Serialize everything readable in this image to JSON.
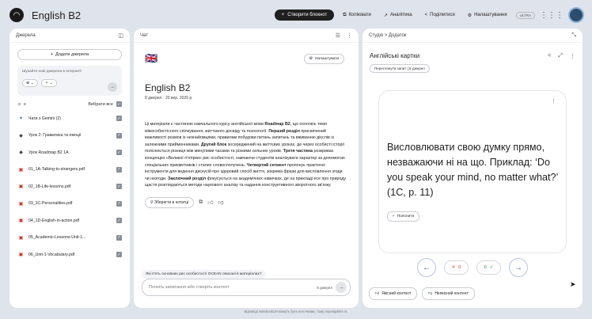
{
  "app": {
    "notebook_title": "English B2",
    "logo_glyph": "◠"
  },
  "topbar": {
    "create_label": "Створити блокнот",
    "copy_label": "Копіювати",
    "analytics_label": "Аналітика",
    "share_label": "Поділитися",
    "settings_label": "Налаштування",
    "plan_badge": "ULTRA"
  },
  "sources": {
    "header": "Джерела",
    "add_label": "Додати джерела",
    "search_placeholder": "Шукайте нові джерела в Інтернеті",
    "select_all_label": "Вибрати все",
    "items": [
      {
        "label": "Чати з Gemini (2)",
        "icon": "gemini-icon"
      },
      {
        "label": "Урок 2: Граматика та емоції",
        "icon": "note-icon"
      },
      {
        "label": "Урок Roadmap B2 1A",
        "icon": "note-icon"
      },
      {
        "label": "01_1A-Talking-to-strangers.pdf",
        "icon": "pdf-icon"
      },
      {
        "label": "02_1B-Life-lessons.pdf",
        "icon": "pdf-icon"
      },
      {
        "label": "03_1C-Personalities.pdf",
        "icon": "pdf-icon"
      },
      {
        "label": "04_1D-English-in-action.pdf",
        "icon": "pdf-icon"
      },
      {
        "label": "05_Academic-Lessons-Unit-1...",
        "icon": "pdf-icon"
      },
      {
        "label": "06_Unit-1-Vocabulary.pdf",
        "icon": "pdf-icon"
      }
    ]
  },
  "chat": {
    "header": "Чат",
    "flag": "🇬🇧",
    "settings_label": "Налаштувати",
    "title": "English B2",
    "meta": "8 джерел · 20 вер. 2026 р.",
    "summary": {
      "p1": "Ці матеріали є частиною навчального курсу англійської мови ",
      "b1": "Roadmap B2",
      "p2": ", що охоплює теми міжособистісного спілкування, життєвого досвіду та психології. ",
      "b2": "Перший розділ",
      "p3": " присвячений важливості розмов із незнайомцями, правилам побудови питань запитань та вживанню дієслів із залежними прийменниками. ",
      "b3": "Другий блок",
      "p4": " зосереджений на життєвих уроках, де через особисті історії пояснюється різниця між минулими часами та різними сильних уроків. ",
      "b4": "Третя частина",
      "p5": " розкриває концепцію «Великої п'ятірки» рис особистості, навчаючи студентів аналізувати характер за допомогою спеціальних прикметників і сталих словосполучень. ",
      "b5": "Четвертий сегмент",
      "p6": " пропонує практичні інструменти для ведення дискусій про здоровий спосіб життя, зокрема фрази для висловлення згоди чи незгоди. ",
      "b6": "Заключний розділ",
      "p7": " фокусується на академічних навичках, де на прикладі есе про природу щастя розглядаються методи наукового аналізу та надання конструктивного зворотного зв'язку."
    },
    "save_note_label": "Зберегти в нотатці",
    "suggestion": "Які п'ять основних рис особистості OCEAN описані в матеріалах?",
    "input_placeholder": "Почніть запитання або створіть контент",
    "source_count": "8 джерел"
  },
  "studio": {
    "breadcrumb": "Студія > Додаток",
    "title": "Англійські картки",
    "review_label": "Переглянути запит | 8 джерел",
    "card_text": "Висловлювати свою думку прямо, незважаючи ні на що. Приклад: ‘Do you speak your mind, no matter what?’ (1C, p. 11)",
    "explain_label": "Пояснити",
    "wrong_count": "0",
    "right_count": "0",
    "good_content_label": "Якісний контент",
    "bad_content_label": "Неякісний контент"
  },
  "footer": {
    "disclaimer": "Відповіді NotebookLM можуть бути неточними, тому перевіряйте їх."
  }
}
